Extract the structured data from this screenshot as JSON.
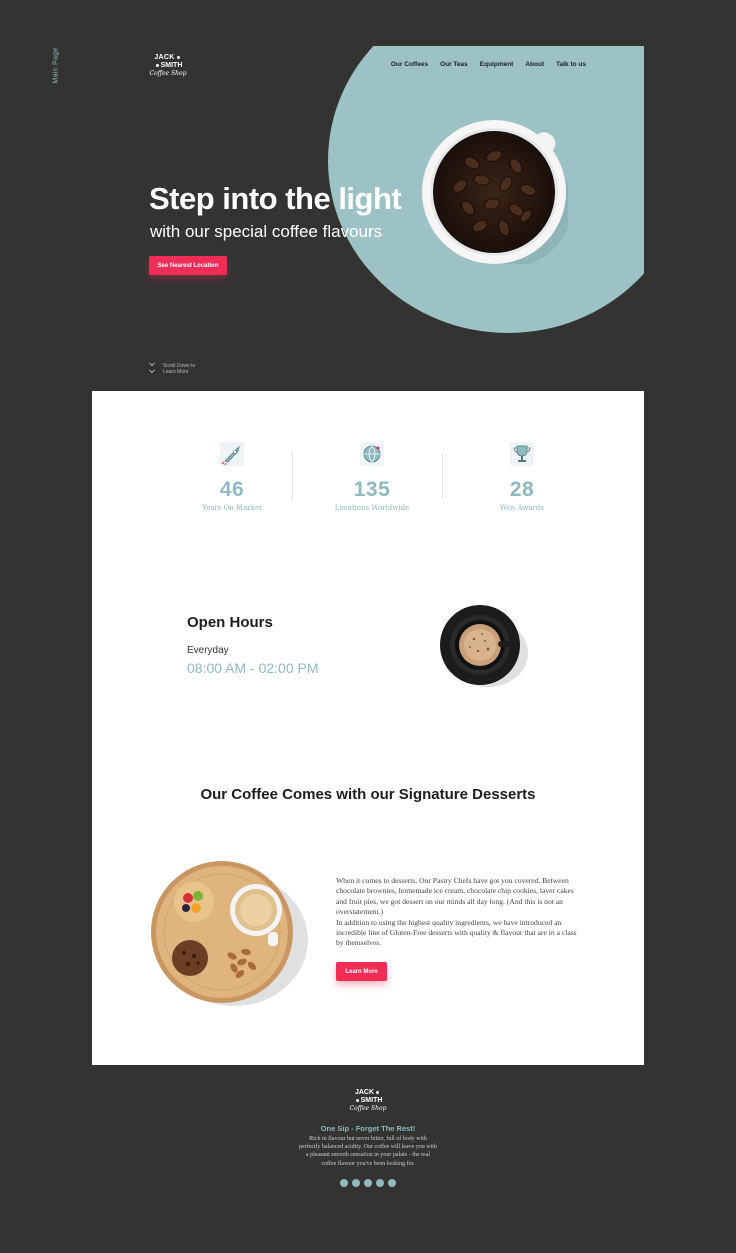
{
  "side_label": "Main Page",
  "brand": {
    "line1": "JACK",
    "line2": "SMITH",
    "line3": "Coffee Shop"
  },
  "nav": [
    "Our Coffees",
    "Our Teas",
    "Equipment",
    "About",
    "Talk to us"
  ],
  "hero": {
    "title": "Step into the light",
    "subtitle": "with our special coffee flavours",
    "cta": "See Nearest Location",
    "scroll_line1": "Scroll Down to",
    "scroll_line2": "Learn More"
  },
  "stats": [
    {
      "icon": "rocket-icon",
      "value": "46",
      "label": "Years On Market"
    },
    {
      "icon": "globe-icon",
      "value": "135",
      "label": "Locations Worldwide"
    },
    {
      "icon": "trophy-icon",
      "value": "28",
      "label": "Won Awards"
    }
  ],
  "open_hours": {
    "title": "Open Hours",
    "day": "Everyday",
    "time": "08:00 AM - 02:00 PM"
  },
  "desserts": {
    "title": "Our Coffee Comes with our Signature Desserts",
    "paragraph1": "When it comes to desserts, Our Pastry Chefs have got you covered. Between chocolate brownies, homemade ice cream, chocolate chip cookies, layer cakes and fruit pies, we got dessert on our minds all day long. (And this is not an overstatement.)",
    "paragraph2": "In addition to using the highest quality ingredients, we have introduced an incredible line of Gluten-Free desserts with quality & flavour that are in a class by themselves.",
    "cta": "Learn More"
  },
  "footer": {
    "tagline": "One Sip - Forget The Rest!",
    "text": "Rich in flavour but never bitter, full of body with perfectly balanced acidity. Our coffee will leave you with a pleasant smooth sensation in your palate - the real coffee flavour you've been looking for.",
    "socials": [
      "social-icon-1",
      "social-icon-2",
      "social-icon-3",
      "social-icon-4",
      "social-icon-5"
    ]
  },
  "colors": {
    "dark": "#333332",
    "teal": "#9dc2c6",
    "accent": "#ef2d56",
    "text_teal": "#8fb9bf"
  }
}
